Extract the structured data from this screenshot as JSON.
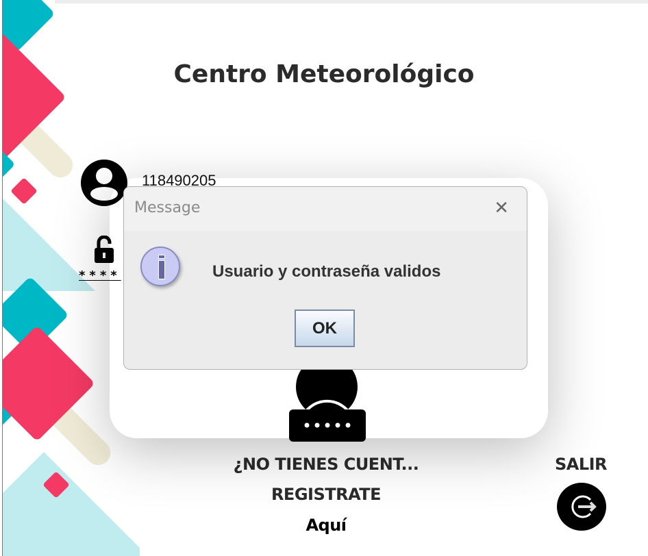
{
  "app": {
    "title": "Centro Meteorológico"
  },
  "login": {
    "user_value": "118490205",
    "password_mask": "****"
  },
  "register": {
    "prompt": "¿NO TIENES CUENT...",
    "register_label": "REGISTRATE",
    "here_link": "Aquí"
  },
  "exit": {
    "label": "SALIR"
  },
  "dialog": {
    "title": "Message",
    "message": "Usuario y contraseña validos",
    "ok_label": "OK",
    "icon": "information-icon"
  },
  "colors": {
    "pink": "#f43a64",
    "cyan": "#00b7c6",
    "light_cyan": "#c0ebef",
    "beige": "#efebd6"
  }
}
